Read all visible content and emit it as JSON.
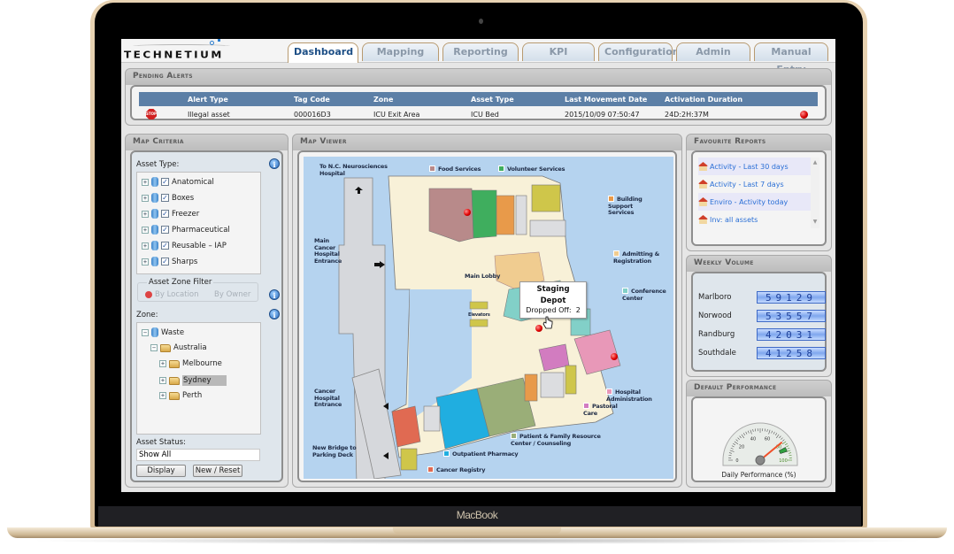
{
  "device": {
    "brand_label": "MacBook"
  },
  "app": {
    "logo_text": "TECHNETIUM",
    "tabs": [
      {
        "label": "Dashboard",
        "active": true
      },
      {
        "label": "Mapping",
        "active": false
      },
      {
        "label": "Reporting",
        "active": false
      },
      {
        "label": "KPI",
        "active": false
      },
      {
        "label": "Configuration",
        "active": false
      },
      {
        "label": "Admin",
        "active": false
      },
      {
        "label": "Manual Entry",
        "active": false
      }
    ]
  },
  "pending_alerts": {
    "title": "Pending Alerts",
    "columns": [
      "",
      "Alert Type",
      "Tag Code",
      "Zone",
      "Asset Type",
      "Last Movement Date",
      "Activation Duration",
      ""
    ],
    "rows": [
      {
        "icon": "stop-icon",
        "icon_text": "STOP",
        "alert_type": "Illegal asset",
        "tag_code": "000016D3",
        "zone": "ICU Exit Area",
        "asset_type": "ICU Bed",
        "last_movement": "2015/10/09 07:50:47",
        "duration": "24D:2H:37M",
        "status_color": "#d40000"
      }
    ]
  },
  "map_criteria": {
    "title": "Map Criteria",
    "asset_type_label": "Asset Type:",
    "asset_types": [
      {
        "label": "Anatomical",
        "checked": true
      },
      {
        "label": "Boxes",
        "checked": true
      },
      {
        "label": "Freezer",
        "checked": true
      },
      {
        "label": "Pharmaceutical",
        "checked": true
      },
      {
        "label": "Reusable – IAP",
        "checked": true
      },
      {
        "label": "Sharps",
        "checked": true
      }
    ],
    "zone_filter": {
      "legend": "Asset Zone Filter",
      "options": [
        "By Location",
        "By Owner"
      ],
      "selected": "By Location"
    },
    "zone_label": "Zone:",
    "zone_tree": [
      {
        "label": "Waste",
        "level": 0,
        "icon": "database",
        "expanded": true
      },
      {
        "label": "Australia",
        "level": 1,
        "icon": "folder",
        "expanded": true
      },
      {
        "label": "Melbourne",
        "level": 2,
        "icon": "folder",
        "expanded": false
      },
      {
        "label": "Sydney",
        "level": 2,
        "icon": "folder",
        "expanded": false,
        "selected": true
      },
      {
        "label": "Perth",
        "level": 2,
        "icon": "folder",
        "expanded": false
      }
    ],
    "asset_status_label": "Asset Status:",
    "asset_status_value": "Show All",
    "display_button": "Display",
    "reset_button": "New / Reset",
    "checkmark": "✓",
    "info_glyph": "i",
    "expand_glyph": "+",
    "collapse_glyph": "−"
  },
  "map_viewer": {
    "title": "Map Viewer",
    "labels": {
      "to_nc": "To N.C. Neurosciences\nHospital",
      "main_entrance": "Main\nCancer\nHospital\nEntrance",
      "cancer_entrance": "Cancer\nHospital\nEntrance",
      "new_bridge": "New Bridge to\nParking Deck",
      "main_lobby": "Main Lobby",
      "elevators": "Elevators"
    },
    "legend": [
      {
        "label": "Food Services",
        "color": "#b88a8a"
      },
      {
        "label": "Volunteer Services",
        "color": "#3fae5e"
      },
      {
        "label": "Building\nSupport\nServices",
        "color": "#e89a4a"
      },
      {
        "label": "Admitting &\nRegistration",
        "color": "#f0cc90"
      },
      {
        "label": "Conference\nCenter",
        "color": "#82d0c8"
      },
      {
        "label": "Hospital\nAdministration",
        "color": "#e898b8"
      },
      {
        "label": "Pastoral\nCare",
        "color": "#d27cc0"
      },
      {
        "label": "Patient & Family Resource\nCenter / Counseling",
        "color": "#9aae78"
      },
      {
        "label": "Outpatient Pharmacy",
        "color": "#20aee0"
      },
      {
        "label": "Cancer Registry",
        "color": "#e06a52"
      }
    ],
    "tooltip": {
      "title_line1": "Staging",
      "title_line2": "Depot",
      "label": "Dropped Off:",
      "value": "2"
    }
  },
  "favourite_reports": {
    "title": "Favourite Reports",
    "items": [
      "Activity - Last 30 days",
      "Activity - Last 7 days",
      "Enviro - Activity today",
      "Inv: all assets"
    ],
    "scroll_up": "▲",
    "scroll_down": "▼"
  },
  "weekly_volume": {
    "title": "Weekly Volume",
    "rows": [
      {
        "label": "Marlboro",
        "value": "59129"
      },
      {
        "label": "Norwood",
        "value": "53557"
      },
      {
        "label": "Randburg",
        "value": "42031"
      },
      {
        "label": "Southdale",
        "value": "41258"
      }
    ]
  },
  "default_performance": {
    "title": "Default Performance",
    "caption": "Daily Performance (%)",
    "gauge": {
      "min": 0,
      "max": 100,
      "ticks": [
        "0",
        "20",
        "40",
        "60",
        "80",
        "100"
      ],
      "value": 78,
      "target": 85,
      "target_color": "#30a040",
      "needle_color": "#f0502a"
    }
  }
}
